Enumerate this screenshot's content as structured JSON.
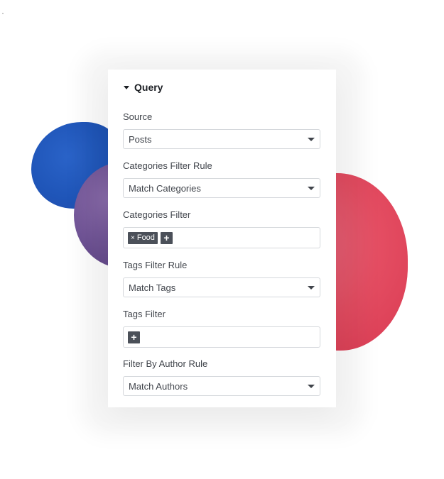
{
  "panel": {
    "section_title": "Query",
    "fields": {
      "source": {
        "label": "Source",
        "value": "Posts"
      },
      "categories_rule": {
        "label": "Categories Filter Rule",
        "value": "Match Categories"
      },
      "categories_filter": {
        "label": "Categories Filter",
        "chips": [
          "Food"
        ],
        "remove_glyph": "×",
        "add_glyph": "+"
      },
      "tags_rule": {
        "label": "Tags Filter Rule",
        "value": "Match Tags"
      },
      "tags_filter": {
        "label": "Tags Filter",
        "add_glyph": "+"
      },
      "author_rule": {
        "label": "Filter By Author Rule",
        "value": "Match Authors"
      }
    }
  },
  "colors": {
    "blob_blue": "#1f55b8",
    "blob_purple": "#6b4f92",
    "blob_red": "#e44d62",
    "chip_bg": "#4b5059"
  }
}
